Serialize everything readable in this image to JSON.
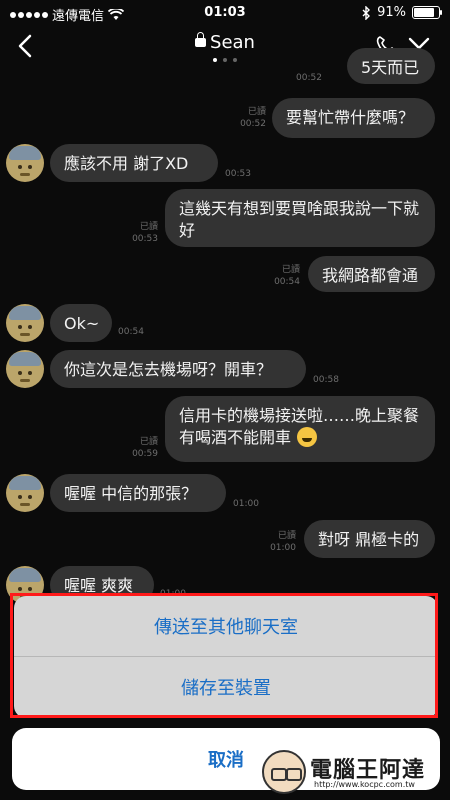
{
  "status_bar": {
    "carrier": "遠傳電信",
    "time": "01:03",
    "battery": "91%"
  },
  "header": {
    "title": "Sean",
    "page_count": 3,
    "active_page": 1
  },
  "messages": [
    {
      "side": "right",
      "text": "5天而已",
      "time": "00:52",
      "read": ""
    },
    {
      "side": "right",
      "text": "要幫忙帶什麼嗎？",
      "time": "00:52",
      "read": "已讀"
    },
    {
      "side": "left",
      "text": "應該不用 謝了XD",
      "time": "00:53"
    },
    {
      "side": "right",
      "text": "這幾天有想到要買啥跟我說一下就好",
      "time": "00:53",
      "read": "已讀"
    },
    {
      "side": "right",
      "text": "我網路都會通",
      "time": "00:54",
      "read": "已讀"
    },
    {
      "side": "left",
      "text": "Ok~",
      "time": "00:54"
    },
    {
      "side": "left",
      "text": "你這次是怎去機場呀？開車？",
      "time": "00:58"
    },
    {
      "side": "right",
      "text": "信用卡的機場接送啦……晚上聚餐有喝酒不能開車",
      "time": "00:59",
      "read": "已讀",
      "emoji": "grin-emoji"
    },
    {
      "side": "left",
      "text": "喔喔 中信的那張？",
      "time": "01:00"
    },
    {
      "side": "right",
      "text": "對呀 鼎極卡的",
      "time": "01:00",
      "read": "已讀"
    },
    {
      "side": "left",
      "text": "喔喔 爽爽",
      "time": "01:00"
    }
  ],
  "action_sheet": {
    "send_to_other_chat": "傳送至其他聊天室",
    "save_to_device": "儲存至裝置",
    "cancel": "取消"
  },
  "watermark": {
    "text": "電腦王阿達",
    "url": "http://www.kocpc.com.tw"
  },
  "colors": {
    "background": "#0b0b0b",
    "bubble": "#333333",
    "action_text": "#1a6ec6",
    "highlight": "#ff1a1a"
  }
}
